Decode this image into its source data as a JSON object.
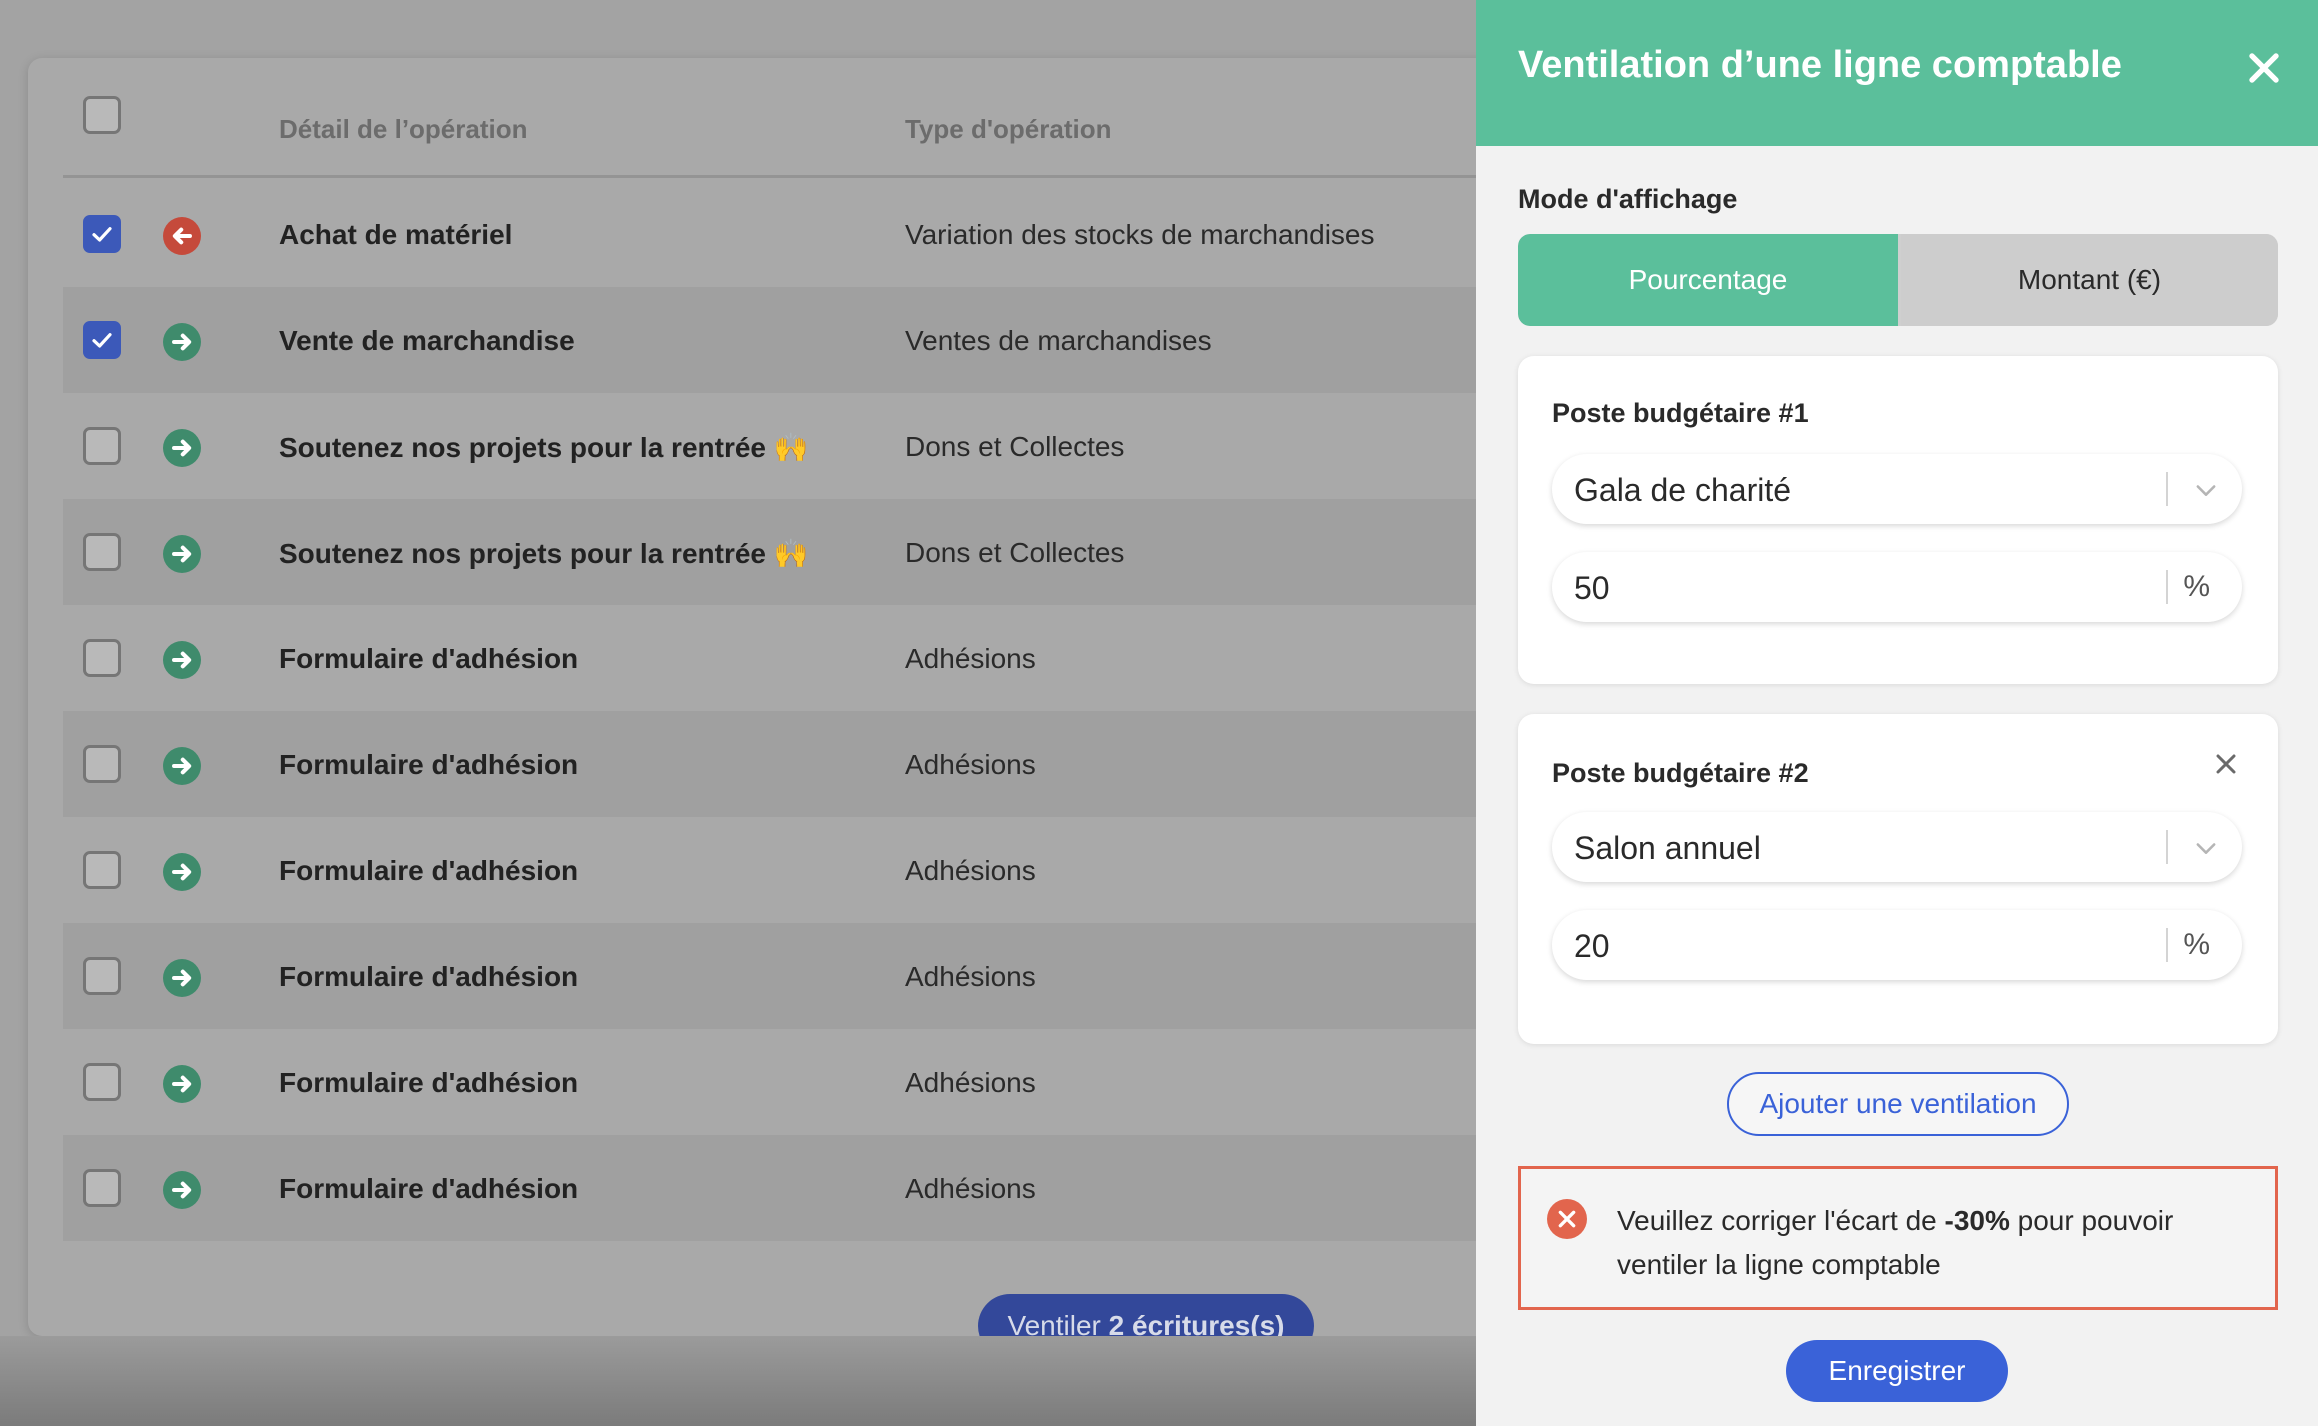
{
  "table": {
    "headers": {
      "detail": "Détail de l’opération",
      "type": "Type d'opération"
    },
    "rows": [
      {
        "checked": true,
        "direction": "out",
        "detail": "Achat de matériel",
        "type": "Variation des stocks de marchandises"
      },
      {
        "checked": true,
        "direction": "in",
        "detail": "Vente de marchandise",
        "type": "Ventes de marchandises"
      },
      {
        "checked": false,
        "direction": "in",
        "detail": "Soutenez nos projets pour la rentrée 🙌",
        "type": "Dons et Collectes"
      },
      {
        "checked": false,
        "direction": "in",
        "detail": "Soutenez nos projets pour la rentrée 🙌",
        "type": "Dons et Collectes"
      },
      {
        "checked": false,
        "direction": "in",
        "detail": "Formulaire d'adhésion",
        "type": "Adhésions"
      },
      {
        "checked": false,
        "direction": "in",
        "detail": "Formulaire d'adhésion",
        "type": "Adhésions"
      },
      {
        "checked": false,
        "direction": "in",
        "detail": "Formulaire d'adhésion",
        "type": "Adhésions"
      },
      {
        "checked": false,
        "direction": "in",
        "detail": "Formulaire d'adhésion",
        "type": "Adhésions"
      },
      {
        "checked": false,
        "direction": "in",
        "detail": "Formulaire d'adhésion",
        "type": "Adhésions"
      },
      {
        "checked": false,
        "direction": "in",
        "detail": "Formulaire d'adhésion",
        "type": "Adhésions"
      }
    ],
    "ventiler_prefix": "Ventiler ",
    "ventiler_count": "2 écritures(s)"
  },
  "panel": {
    "title": "Ventilation d’une ligne comptable",
    "mode_label": "Mode d'affichage",
    "mode_percent": "Pourcentage",
    "mode_amount": "Montant (€)",
    "postes": [
      {
        "title": "Poste budgétaire #1",
        "selected": "Gala de charité",
        "value": "50",
        "unit": "%"
      },
      {
        "title": "Poste budgétaire #2",
        "selected": "Salon annuel",
        "value": "20",
        "unit": "%"
      }
    ],
    "add_label": "Ajouter une ventilation",
    "error": {
      "before": "Veuillez corriger l'écart de ",
      "highlight": "-30%",
      "after": " pour pouvoir ventiler la ligne comptable"
    },
    "save_label": "Enregistrer"
  },
  "colors": {
    "accent_green": "#5bbf9b",
    "primary_blue": "#3a62d8",
    "error_red": "#e2654d",
    "checked_blue": "#3c59b9"
  }
}
